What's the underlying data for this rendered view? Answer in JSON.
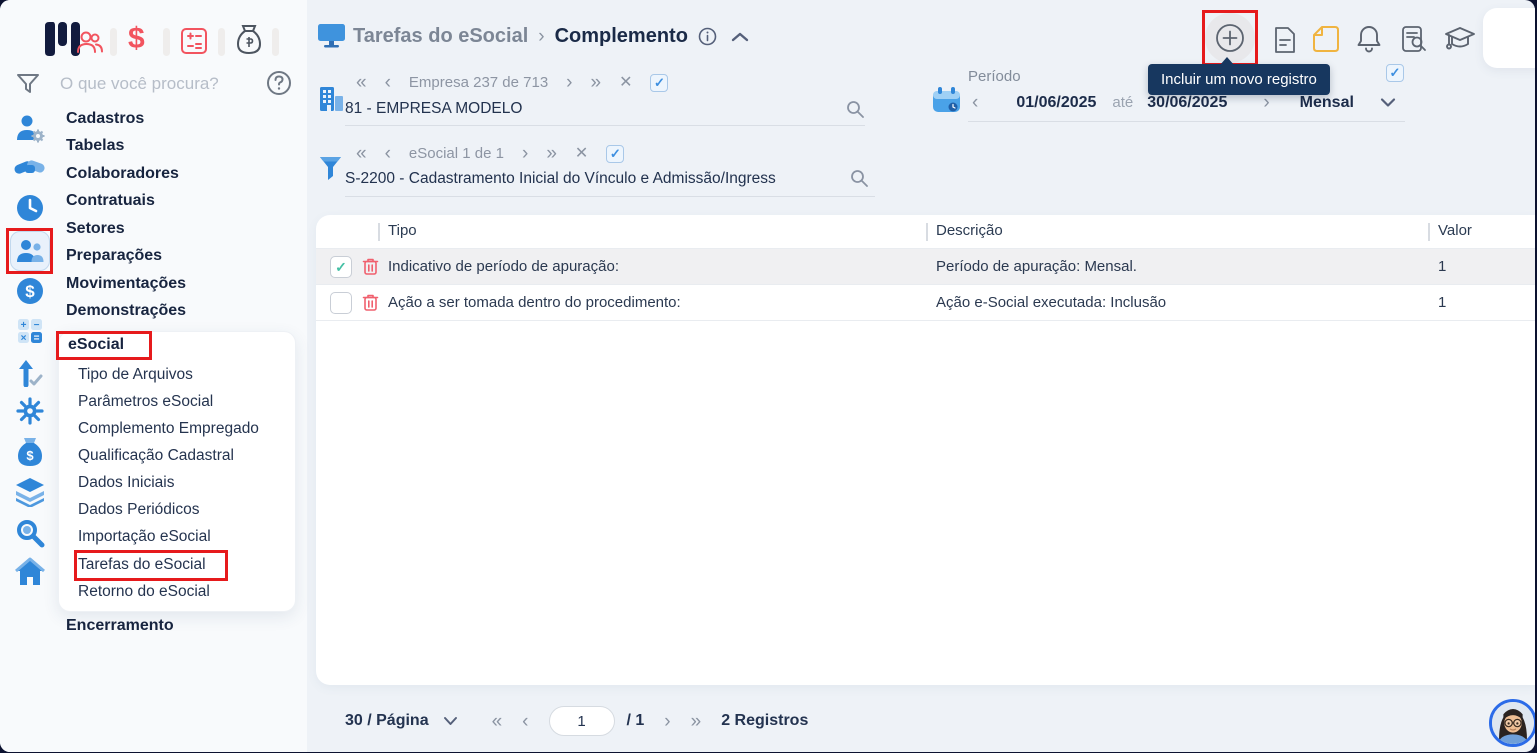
{
  "colors": {
    "accent_blue": "#2f86d8",
    "annotation_red": "#e61a1c",
    "tooltip_bg": "#17375f",
    "danger": "#f0606e",
    "check_green": "#45c0a5"
  },
  "glyphs": {
    "first": "«",
    "prev": "‹",
    "next": "›",
    "last": "»",
    "close": "✕",
    "check": "✓",
    "question": "?"
  },
  "sidebar": {
    "search_placeholder": "O que você procura?",
    "menu": [
      "Cadastros",
      "Tabelas",
      "Colaboradores",
      "Contratuais",
      "Setores",
      "Preparações",
      "Movimentações",
      "Demonstrações"
    ],
    "esocial": {
      "label": "eSocial",
      "items": [
        "Tipo de Arquivos",
        "Parâmetros eSocial",
        "Complemento Empregado",
        "Qualificação Cadastral",
        "Dados Iniciais",
        "Dados Periódicos",
        "Importação eSocial",
        "Tarefas do eSocial",
        "Retorno do eSocial"
      ]
    },
    "closing": "Encerramento"
  },
  "breadcrumb": {
    "parent": "Tarefas do eSocial",
    "current": "Complemento"
  },
  "company_nav": {
    "label": "Empresa 237 de 713",
    "value": "81 - EMPRESA MODELO"
  },
  "filter_nav": {
    "label": "eSocial 1 de 1",
    "value": "S-2200 - Cadastramento Inicial do Vínculo e Admissão/Ingress"
  },
  "period": {
    "label": "Período",
    "start": "01/06/2025",
    "until": "até",
    "end": "30/06/2025",
    "mode": "Mensal"
  },
  "tooltip": {
    "text": "Incluir um novo registro"
  },
  "table": {
    "columns": [
      "Tipo",
      "Descrição",
      "Valor"
    ],
    "rows": [
      {
        "check": "✓",
        "tipo": "Indicativo de período de apuração:",
        "descricao": "Período de apuração: Mensal.",
        "valor": "1"
      },
      {
        "check": "",
        "tipo": "Ação a ser tomada dentro do procedimento:",
        "descricao": "Ação e-Social executada: Inclusão",
        "valor": "1"
      }
    ]
  },
  "pagination": {
    "page_size": "30 / Página",
    "current_page": "1",
    "total_pages": "/ 1",
    "records": "2 Registros"
  }
}
